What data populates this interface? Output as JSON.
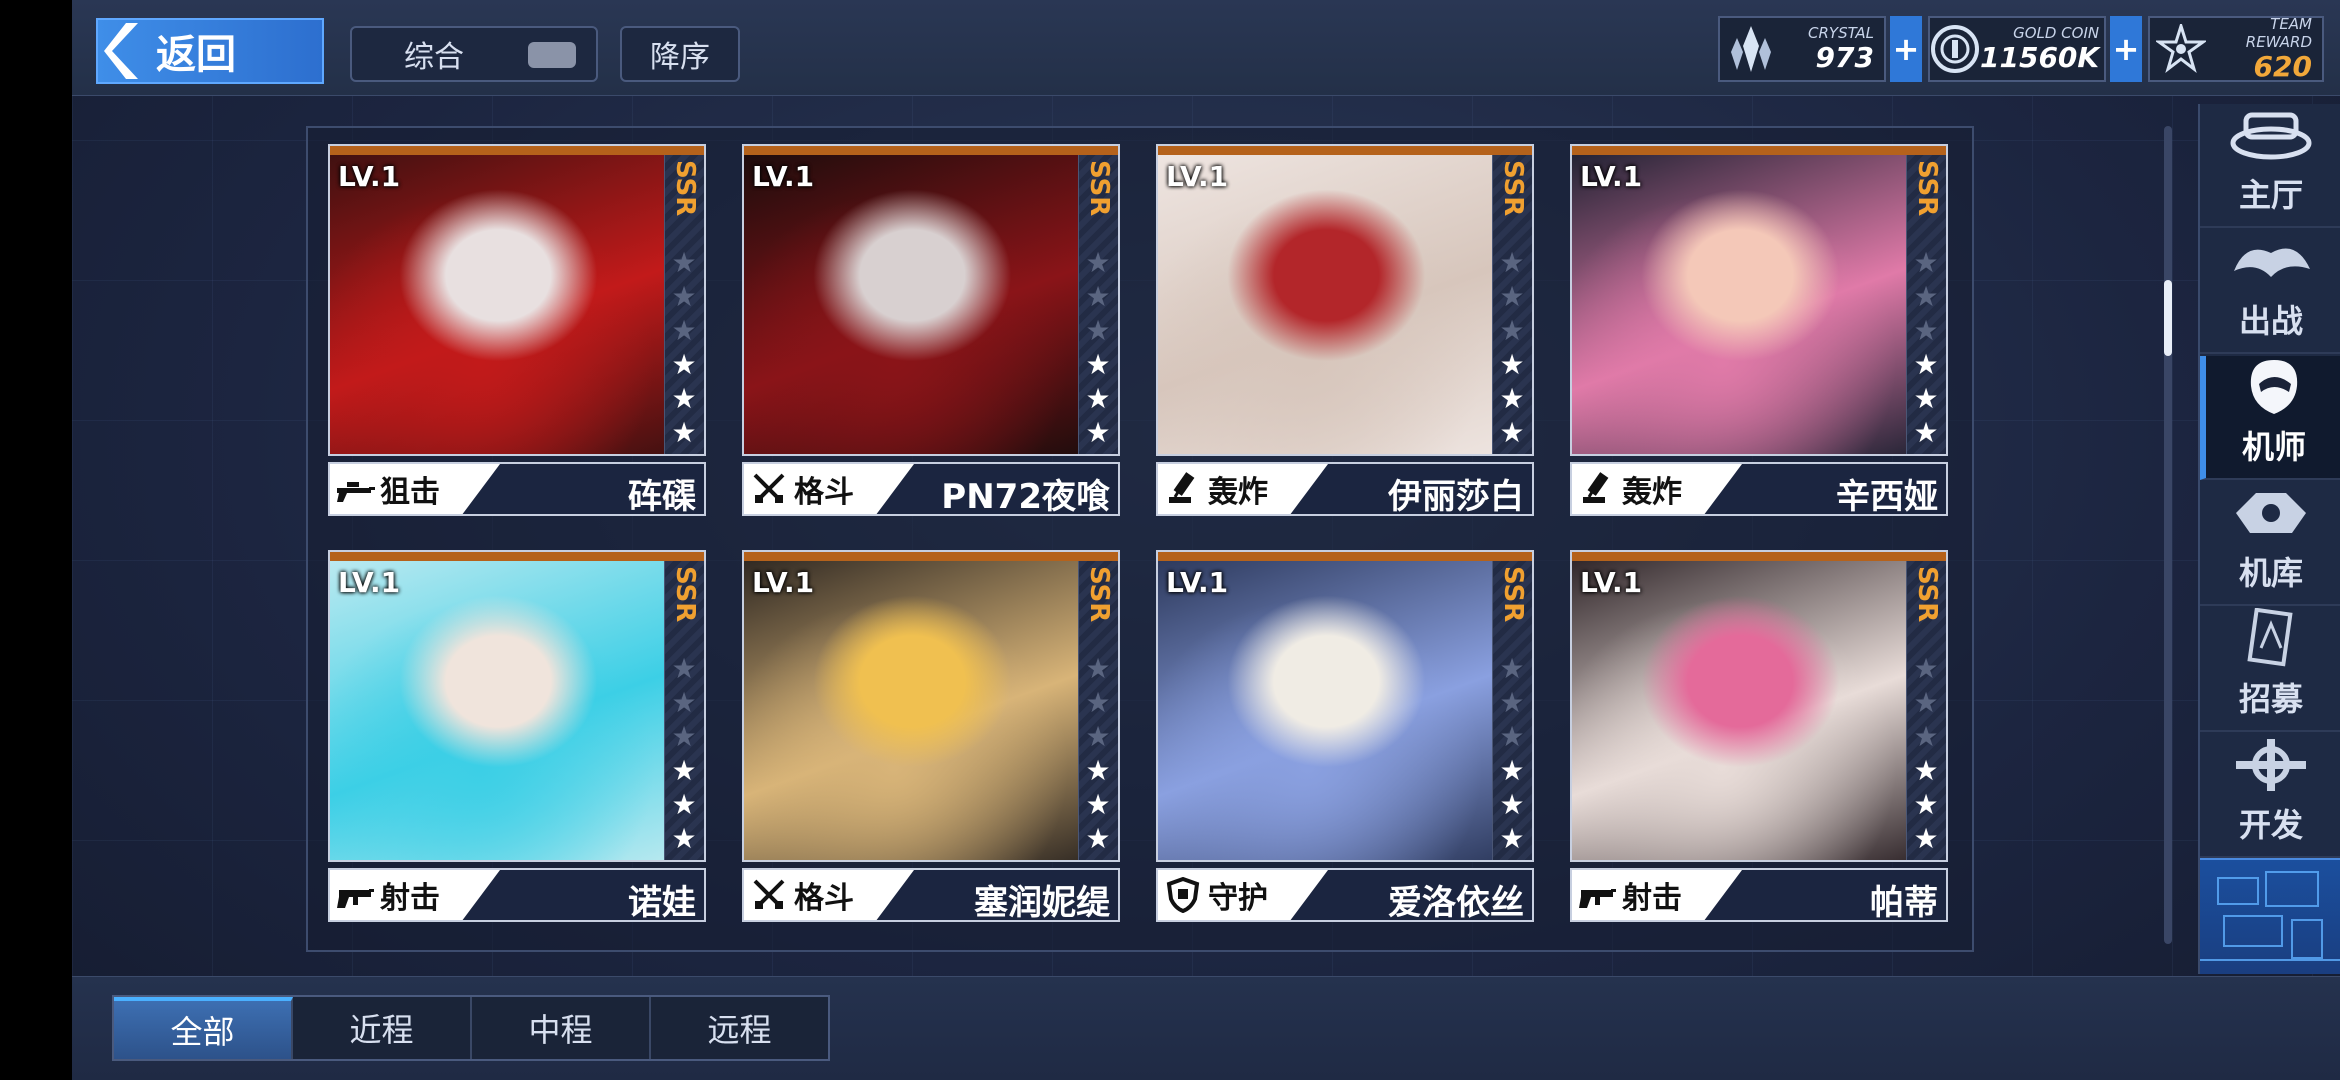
{
  "header": {
    "back_label": "返回",
    "sort_label": "综合",
    "order_label": "降序",
    "currencies": [
      {
        "caption": "CRYSTAL",
        "value": "973",
        "icon": "crystal-icon"
      },
      {
        "caption": "GOLD COIN",
        "value": "11560K",
        "icon": "gold-coin-icon"
      },
      {
        "caption": "TEAM REWARD",
        "value": "620",
        "icon": "team-reward-icon"
      }
    ],
    "plus": "+"
  },
  "cards": [
    {
      "level": "LV.1",
      "rarity": "SSR",
      "stars_on": 3,
      "stars_total": 6,
      "type_label": "狙击",
      "type_icon": "sniper-rifle-icon",
      "name": "砗磲",
      "art_colors": [
        "#3b1010",
        "#c21a1a",
        "#e8e0e0"
      ]
    },
    {
      "level": "LV.1",
      "rarity": "SSR",
      "stars_on": 3,
      "stars_total": 6,
      "type_label": "格斗",
      "type_icon": "crossed-swords-icon",
      "name": "PN72夜喰",
      "art_colors": [
        "#1a0c0c",
        "#8a1418",
        "#d8d0d0"
      ]
    },
    {
      "level": "LV.1",
      "rarity": "SSR",
      "stars_on": 3,
      "stars_total": 6,
      "type_label": "轰炸",
      "type_icon": "mortar-icon",
      "name": "伊丽莎白",
      "art_colors": [
        "#efe6e2",
        "#d7c6bc",
        "#b3262a"
      ]
    },
    {
      "level": "LV.1",
      "rarity": "SSR",
      "stars_on": 3,
      "stars_total": 6,
      "type_label": "轰炸",
      "type_icon": "mortar-icon",
      "name": "辛西娅",
      "art_colors": [
        "#1c2030",
        "#e07aa8",
        "#f4c8b8"
      ]
    },
    {
      "level": "LV.1",
      "rarity": "SSR",
      "stars_on": 3,
      "stars_total": 6,
      "type_label": "射击",
      "type_icon": "rifle-icon",
      "name": "诺娃",
      "art_colors": [
        "#bfeaf0",
        "#3ccfe6",
        "#f0e4dc"
      ]
    },
    {
      "level": "LV.1",
      "rarity": "SSR",
      "stars_on": 3,
      "stars_total": 6,
      "type_label": "格斗",
      "type_icon": "crossed-swords-icon",
      "name": "塞润妮缇",
      "art_colors": [
        "#2a2420",
        "#d8b478",
        "#f0c050"
      ]
    },
    {
      "level": "LV.1",
      "rarity": "SSR",
      "stars_on": 3,
      "stars_total": 6,
      "type_label": "守护",
      "type_icon": "shield-icon",
      "name": "爱洛依丝",
      "art_colors": [
        "#2a3658",
        "#8aa0e0",
        "#f0ece4"
      ]
    },
    {
      "level": "LV.1",
      "rarity": "SSR",
      "stars_on": 3,
      "stars_total": 6,
      "type_label": "射击",
      "type_icon": "rifle-icon",
      "name": "帕蒂",
      "art_colors": [
        "#2a2024",
        "#e8dcd8",
        "#e46a9a"
      ]
    }
  ],
  "nav": [
    {
      "label": "主厅",
      "icon": "main-hall-icon"
    },
    {
      "label": "出战",
      "icon": "sortie-icon"
    },
    {
      "label": "机师",
      "icon": "pilot-icon",
      "active": true
    },
    {
      "label": "机库",
      "icon": "hangar-icon"
    },
    {
      "label": "招募",
      "icon": "recruit-icon"
    },
    {
      "label": "开发",
      "icon": "develop-icon"
    }
  ],
  "tabs": [
    {
      "label": "全部",
      "active": true
    },
    {
      "label": "近程"
    },
    {
      "label": "中程"
    },
    {
      "label": "远程"
    }
  ]
}
